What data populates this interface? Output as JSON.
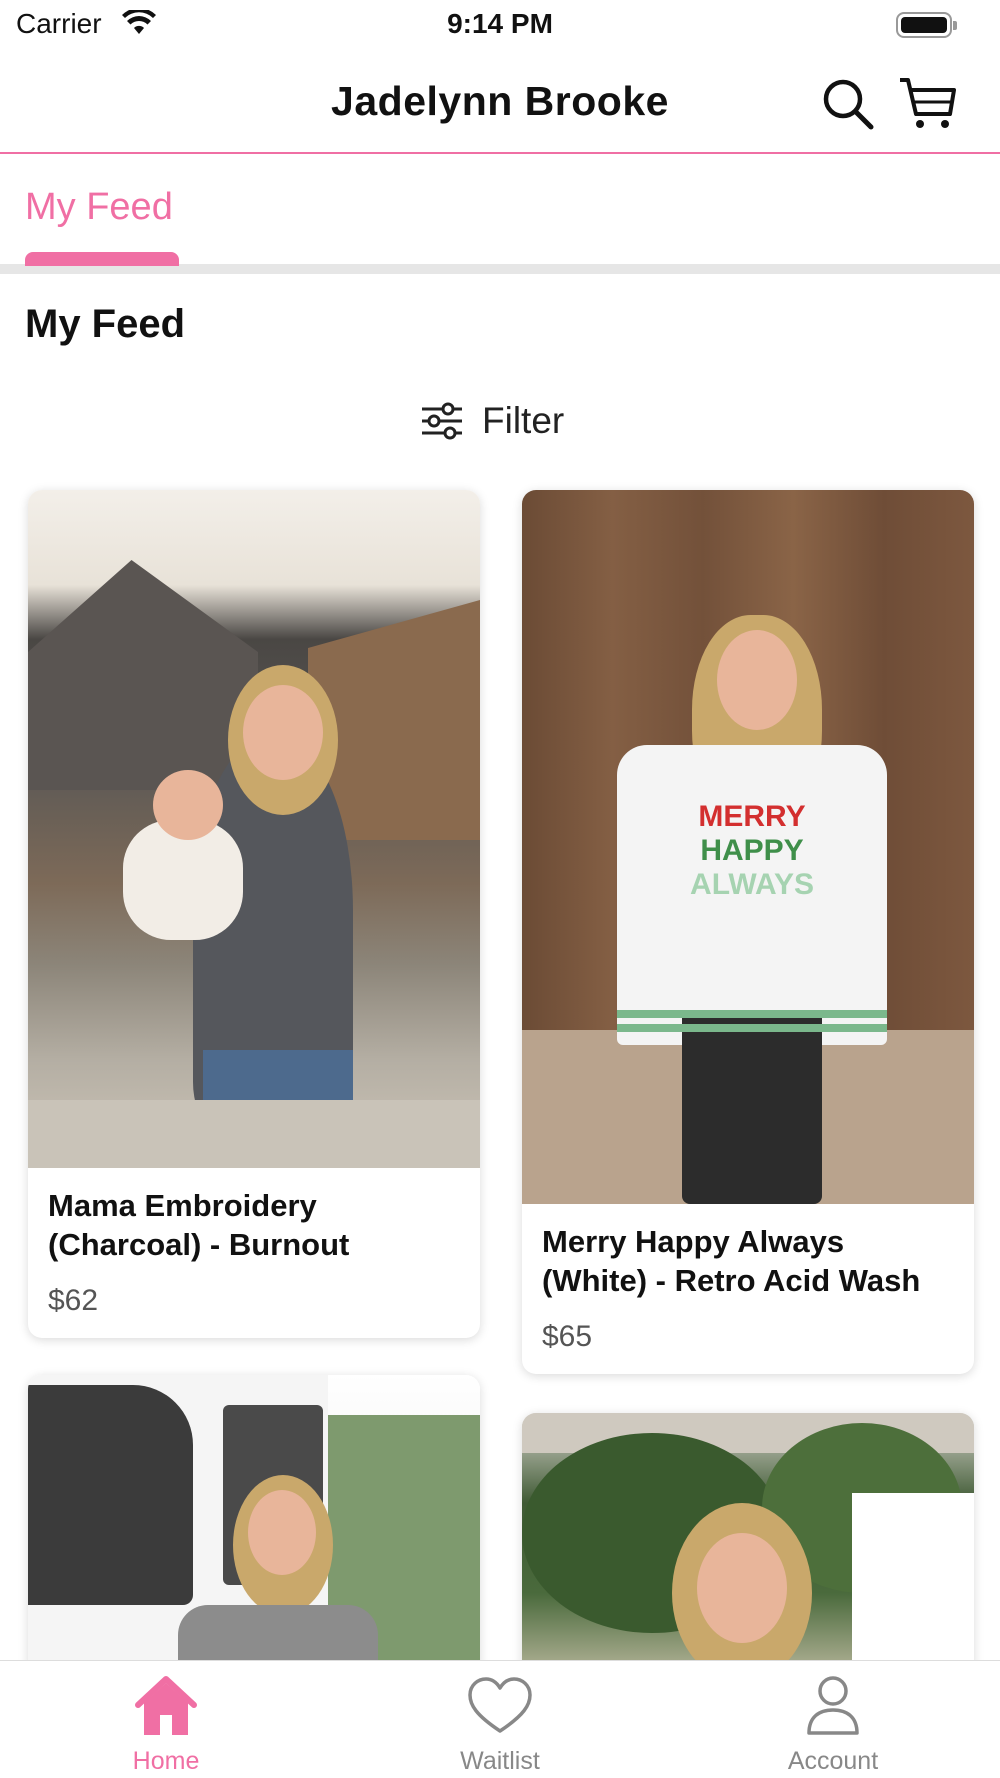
{
  "status_bar": {
    "carrier": "Carrier",
    "time": "9:14 PM"
  },
  "header": {
    "title": "Jadelynn Brooke",
    "search_icon": "search-icon",
    "cart_icon": "cart-icon"
  },
  "tabs": [
    {
      "label": "My Feed",
      "active": true
    }
  ],
  "section": {
    "title": "My Feed"
  },
  "filter": {
    "label": "Filter",
    "icon": "sliders-icon"
  },
  "products": [
    {
      "name": "Mama Embroidery (Charcoal) - Burnout",
      "price": "$62"
    },
    {
      "name": "Merry Happy Always (White) - Retro Acid Wash",
      "price": "$65"
    },
    {
      "name": "",
      "price": ""
    },
    {
      "name": "",
      "price": ""
    }
  ],
  "bottom_nav": [
    {
      "label": "Home",
      "icon": "home-icon",
      "active": true
    },
    {
      "label": "Waitlist",
      "icon": "heart-icon",
      "active": false
    },
    {
      "label": "Account",
      "icon": "person-icon",
      "active": false
    }
  ],
  "colors": {
    "accent": "#f06fa4",
    "tab_divider": "#e6e6e6",
    "inactive_nav": "#888888"
  }
}
